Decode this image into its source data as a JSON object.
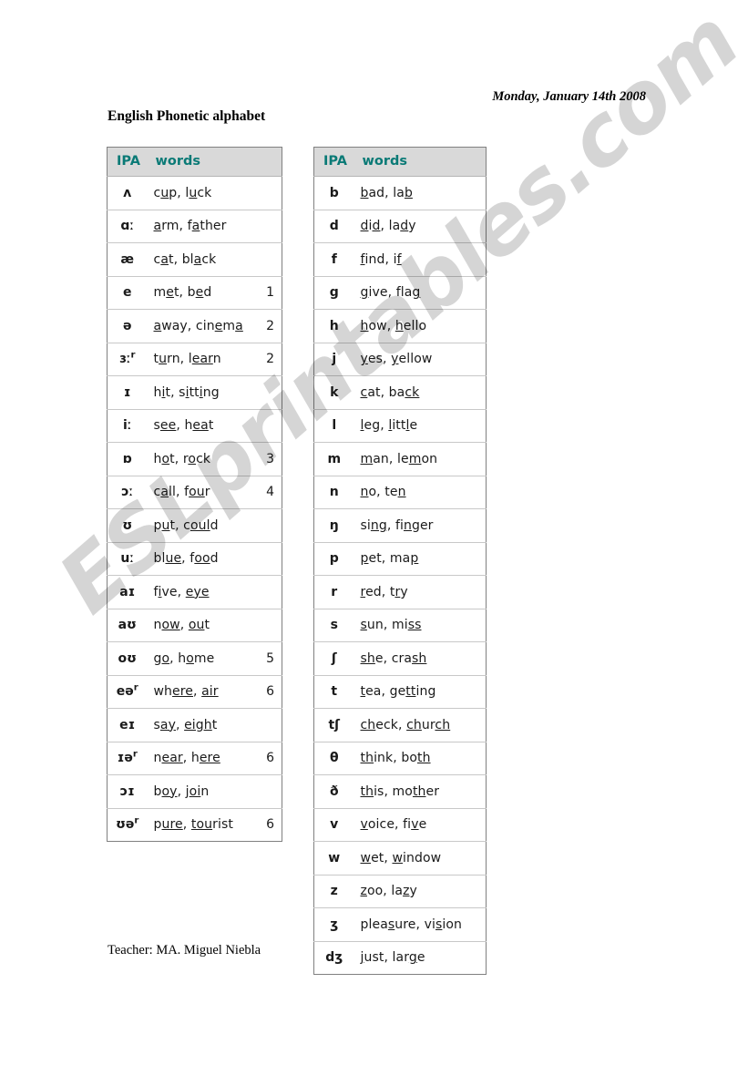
{
  "document": {
    "date": "Monday, January 14th  2008",
    "title": "English Phonetic alphabet",
    "footer": "Teacher: MA. Miguel Niebla",
    "watermark": "ESLprintables.com",
    "header_text_color": "#0a7a76",
    "header_bg_color": "#d9d9d9",
    "border_color": "#808080"
  },
  "tables": {
    "vowels": {
      "headers": {
        "ipa": "IPA",
        "words": "words",
        "num": ""
      },
      "rows": [
        {
          "ipa": "ʌ",
          "words_html": "c<u>u</u>p, l<u>u</u>ck",
          "words_text": "cup, luck",
          "num": ""
        },
        {
          "ipa": "ɑː",
          "words_html": "<u>a</u>rm, f<u>a</u>ther",
          "words_text": "arm, father",
          "num": ""
        },
        {
          "ipa": "æ",
          "words_html": "c<u>a</u>t, bl<u>a</u>ck",
          "words_text": "cat, black",
          "num": ""
        },
        {
          "ipa": "e",
          "words_html": "m<u>e</u>t, b<u>e</u>d",
          "words_text": "met, bed",
          "num": "1"
        },
        {
          "ipa": "ə",
          "words_html": "<u>a</u>way, cin<u>e</u>m<u>a</u>",
          "words_text": "away, cinema",
          "num": "2"
        },
        {
          "ipa": "ɜːʳ",
          "words_html": "t<u>u</u>rn, l<u>ear</u>n",
          "words_text": "turn, learn",
          "num": "2"
        },
        {
          "ipa": "ɪ",
          "words_html": "h<u>i</u>t, s<u>i</u>tt<u>i</u>ng",
          "words_text": "hit, sitting",
          "num": ""
        },
        {
          "ipa": "iː",
          "words_html": "s<u>ee</u>, h<u>ea</u>t",
          "words_text": "see, heat",
          "num": ""
        },
        {
          "ipa": "ɒ",
          "words_html": "h<u>o</u>t, r<u>o</u>ck",
          "words_text": "hot, rock",
          "num": "3"
        },
        {
          "ipa": "ɔː",
          "words_html": "c<u>a</u>ll, f<u>ou</u>r",
          "words_text": "call, four",
          "num": "4"
        },
        {
          "ipa": "ʊ",
          "words_html": "p<u>u</u>t, c<u>oul</u>d",
          "words_text": "put, could",
          "num": ""
        },
        {
          "ipa": "uː",
          "words_html": "bl<u>ue</u>, f<u>oo</u>d",
          "words_text": "blue, food",
          "num": ""
        },
        {
          "ipa": "aɪ",
          "words_html": "f<u>i</u>ve, <u>eye</u>",
          "words_text": "five, eye",
          "num": ""
        },
        {
          "ipa": "aʊ",
          "words_html": "n<u>ow</u>, <u>ou</u>t",
          "words_text": "now, out",
          "num": ""
        },
        {
          "ipa": "oʊ",
          "words_html": "g<u>o</u>, h<u>o</u>me",
          "words_text": "go, home",
          "num": "5"
        },
        {
          "ipa": "eəʳ",
          "words_html": "wh<u>ere</u>, <u>air</u>",
          "words_text": "where, air",
          "num": "6"
        },
        {
          "ipa": "eɪ",
          "words_html": "s<u>ay</u>, <u>eigh</u>t",
          "words_text": "say, eight",
          "num": ""
        },
        {
          "ipa": "ɪəʳ",
          "words_html": "n<u>ear</u>, h<u>ere</u>",
          "words_text": "near, here",
          "num": "6"
        },
        {
          "ipa": "ɔɪ",
          "words_html": "b<u>oy</u>, j<u>oi</u>n",
          "words_text": "boy, join",
          "num": ""
        },
        {
          "ipa": "ʊəʳ",
          "words_html": "p<u>ure</u>, <u>tou</u>rist",
          "words_text": "pure, tourist",
          "num": "6"
        }
      ]
    },
    "consonants": {
      "headers": {
        "ipa": "IPA",
        "words": "words"
      },
      "rows": [
        {
          "ipa": "b",
          "words_html": "<u>b</u>ad, la<u>b</u>",
          "words_text": "bad, lab"
        },
        {
          "ipa": "d",
          "words_html": "<u>d</u>i<u>d</u>, la<u>d</u>y",
          "words_text": "did, lady"
        },
        {
          "ipa": "f",
          "words_html": "<u>f</u>ind, i<u>f</u>",
          "words_text": "find, if"
        },
        {
          "ipa": "g",
          "words_html": "<u>g</u>ive, fla<u>g</u>",
          "words_text": "give, flag"
        },
        {
          "ipa": "h",
          "words_html": "<u>h</u>ow, <u>h</u>ello",
          "words_text": "how, hello"
        },
        {
          "ipa": "j",
          "words_html": "<u>y</u>es, <u>y</u>ellow",
          "words_text": "yes, yellow"
        },
        {
          "ipa": "k",
          "words_html": "<u>c</u>at, ba<u>ck</u>",
          "words_text": "cat, back"
        },
        {
          "ipa": "l",
          "words_html": "<u>l</u>eg, <u>l</u>itt<u>l</u>e",
          "words_text": "leg, little"
        },
        {
          "ipa": "m",
          "words_html": "<u>m</u>an, le<u>m</u>on",
          "words_text": "man, lemon"
        },
        {
          "ipa": "n",
          "words_html": "<u>n</u>o, te<u>n</u>",
          "words_text": "no, ten"
        },
        {
          "ipa": "ŋ",
          "words_html": "si<u>ng</u>, fi<u>n</u>ger",
          "words_text": "sing, finger"
        },
        {
          "ipa": "p",
          "words_html": "<u>p</u>et, ma<u>p</u>",
          "words_text": "pet, map"
        },
        {
          "ipa": "r",
          "words_html": "<u>r</u>ed, t<u>r</u>y",
          "words_text": "red, try"
        },
        {
          "ipa": "s",
          "words_html": "<u>s</u>un, mi<u>ss</u>",
          "words_text": "sun, miss"
        },
        {
          "ipa": "ʃ",
          "words_html": "<u>sh</u>e, cra<u>sh</u>",
          "words_text": "she, crash"
        },
        {
          "ipa": "t",
          "words_html": "<u>t</u>ea, ge<u>tt</u>ing",
          "words_text": "tea, getting"
        },
        {
          "ipa": "tʃ",
          "words_html": "<u>ch</u>eck, <u>ch</u>ur<u>ch</u>",
          "words_text": "check, church"
        },
        {
          "ipa": "θ",
          "words_html": "<u>th</u>ink, bo<u>th</u>",
          "words_text": "think, both"
        },
        {
          "ipa": "ð",
          "words_html": "<u>th</u>is, mo<u>th</u>er",
          "words_text": "this, mother"
        },
        {
          "ipa": "v",
          "words_html": "<u>v</u>oice, fi<u>v</u>e",
          "words_text": "voice, five"
        },
        {
          "ipa": "w",
          "words_html": "<u>w</u>et, <u>w</u>indow",
          "words_text": "wet, window"
        },
        {
          "ipa": "z",
          "words_html": "<u>z</u>oo, la<u>z</u>y",
          "words_text": "zoo, lazy"
        },
        {
          "ipa": "ʒ",
          "words_html": "plea<u>s</u>ure, vi<u>s</u>ion",
          "words_text": "pleasure, vision"
        },
        {
          "ipa": "dʒ",
          "words_html": "<u>j</u>ust, lar<u>g</u>e",
          "words_text": "just, large"
        }
      ]
    }
  }
}
